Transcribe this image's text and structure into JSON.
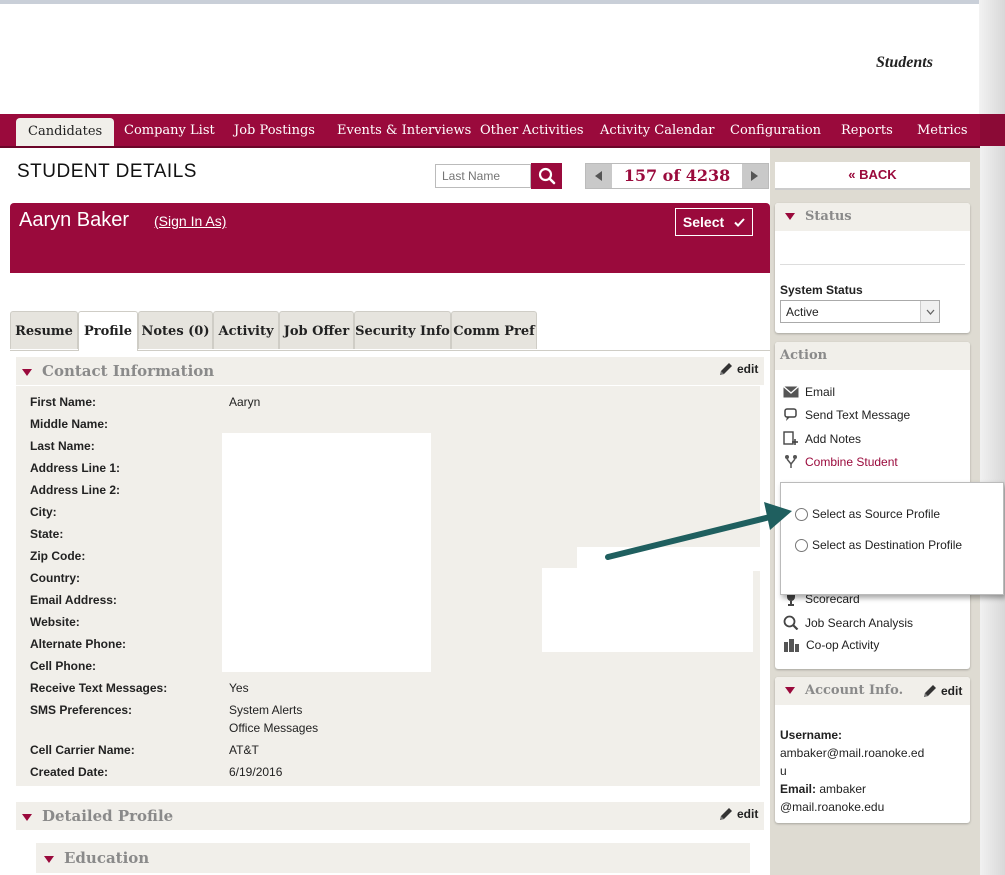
{
  "header": {
    "title": "Students"
  },
  "nav": {
    "tabs": [
      "Candidates",
      "Company List",
      "Job Postings",
      "Events & Interviews",
      "Other Activities",
      "Activity Calendar",
      "Configuration",
      "Reports",
      "Metrics"
    ]
  },
  "page": {
    "heading": "STUDENT DETAILS",
    "search_placeholder": "Last Name",
    "pager_text": "157 of 4238",
    "back_label": "« BACK"
  },
  "student": {
    "name": "Aaryn Baker",
    "sign_in_as": "(Sign In As)",
    "select_label": "Select"
  },
  "profile_tabs": [
    "Resume",
    "Profile",
    "Notes (0)",
    "Activity",
    "Job Offer",
    "Security Info",
    "Comm Pref"
  ],
  "contact": {
    "title": "Contact Information",
    "edit_label": "edit",
    "fields": [
      {
        "label": "First Name:",
        "value": "Aaryn"
      },
      {
        "label": "Middle Name:",
        "value": ""
      },
      {
        "label": "Last Name:",
        "value": ""
      },
      {
        "label": "Address Line 1:",
        "value": ""
      },
      {
        "label": "Address Line 2:",
        "value": ""
      },
      {
        "label": "City:",
        "value": ""
      },
      {
        "label": "State:",
        "value": ""
      },
      {
        "label": "Zip Code:",
        "value": ""
      },
      {
        "label": "Country:",
        "value": ""
      },
      {
        "label": "Email Address:",
        "value": ""
      },
      {
        "label": "Website:",
        "value": ""
      },
      {
        "label": "Alternate Phone:",
        "value": ""
      },
      {
        "label": "Cell Phone:",
        "value": ""
      },
      {
        "label": "Receive Text Messages:",
        "value": "Yes"
      },
      {
        "label": "SMS Preferences:",
        "value": "System Alerts",
        "value2": "Office Messages"
      },
      {
        "label": "Cell Carrier Name:",
        "value": "AT&T"
      },
      {
        "label": "Created Date:",
        "value": "6/19/2016"
      }
    ]
  },
  "detailed": {
    "title": "Detailed Profile",
    "edit_label": "edit",
    "education_title": "Education"
  },
  "status_panel": {
    "title": "Status",
    "system_status_label": "System Status",
    "system_status_value": "Active"
  },
  "action_panel": {
    "title": "Action",
    "items": [
      {
        "label": "Email",
        "icon": "envelope-icon"
      },
      {
        "label": "Send Text Message",
        "icon": "chat-icon"
      },
      {
        "label": "Add Notes",
        "icon": "note-add-icon"
      },
      {
        "label": "Combine Student",
        "icon": "combine-icon"
      },
      {
        "label": "Scorecard",
        "icon": "trophy-icon"
      },
      {
        "label": "Job Search Analysis",
        "icon": "magnifier-icon"
      },
      {
        "label": "Co-op Activity",
        "icon": "building-icon"
      }
    ]
  },
  "combine_popup": {
    "source_label": "Select as Source Profile",
    "destination_label": "Select as Destination Profile"
  },
  "account_panel": {
    "title": "Account Info.",
    "edit_label": "edit",
    "username_label": "Username:",
    "username_line1": "ambaker@mail.roanoke.ed",
    "username_line2": "u",
    "email_label": "Email:",
    "email_line1": "ambaker",
    "email_line2": "@mail.roanoke.edu"
  },
  "colors": {
    "brand": "#9a0a3c",
    "arrow": "#1f5f5f"
  }
}
